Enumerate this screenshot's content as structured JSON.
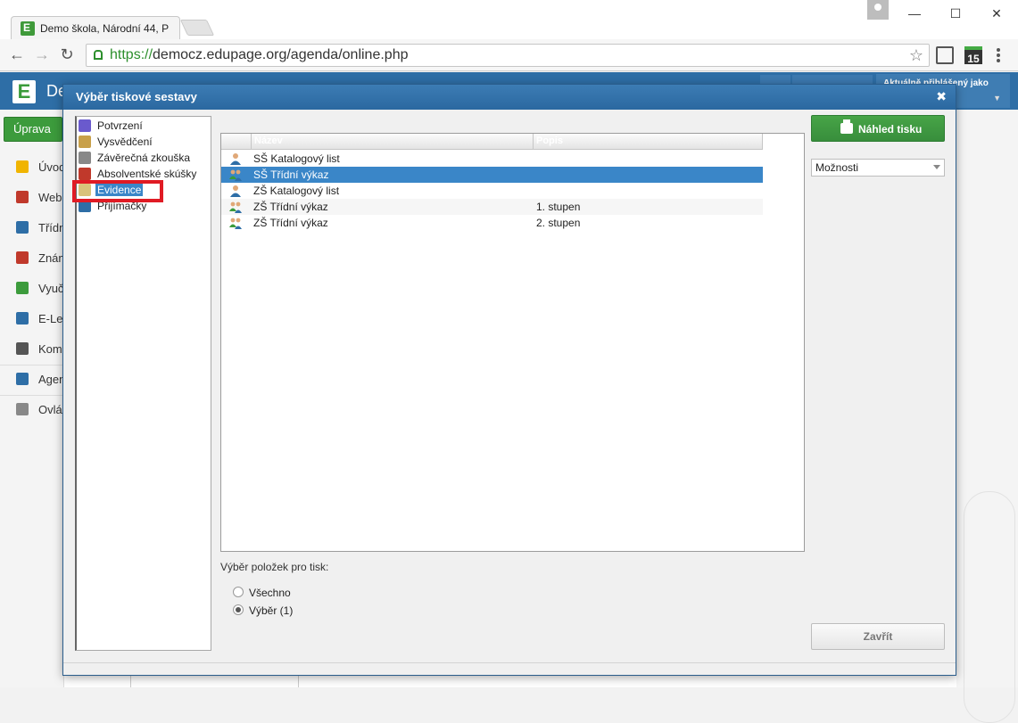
{
  "browser": {
    "tab_title": "Demo škola, Národní 44, P",
    "url_scheme": "https://",
    "url_rest": "democz.edupage.org/agenda/online.php",
    "minimize": "—",
    "maximize": "☐",
    "close": "✕",
    "calendar_badge": "15"
  },
  "app": {
    "logo_letter": "E",
    "title": "De",
    "login_text": "Aktuálně přihlášený jako",
    "edit_button": "Úprava",
    "sidebar": [
      {
        "label": "Úvod",
        "icon": "star-icon",
        "color": "#f0b400"
      },
      {
        "label": "Web",
        "icon": "web-icon",
        "color": "#c0392b"
      },
      {
        "label": "Třídn",
        "icon": "book-icon",
        "color": "#2e6ea6"
      },
      {
        "label": "Znám",
        "icon": "grades-icon",
        "color": "#c0392b"
      },
      {
        "label": "Vyuč",
        "icon": "teaching-icon",
        "color": "#3c9b3c"
      },
      {
        "label": "E-Le",
        "icon": "elearning-icon",
        "color": "#2e6ea6"
      },
      {
        "label": "Kom",
        "icon": "communication-icon",
        "color": "#555555"
      },
      {
        "label": "Agen",
        "icon": "pen-icon",
        "color": "#2e6ea6"
      },
      {
        "label": "Ovlá",
        "icon": "gear-icon",
        "color": "#888888"
      }
    ]
  },
  "dialog": {
    "title": "Výběr tiskové sestavy",
    "close_glyph": "✖",
    "tree": [
      {
        "label": "Potvrzení",
        "icon": "certificate-icon",
        "color": "#6a5acd"
      },
      {
        "label": "Vysvědčení",
        "icon": "report-card-icon",
        "color": "#c8a04a"
      },
      {
        "label": "Závěrečná zkouška",
        "icon": "exam-icon",
        "color": "#888888"
      },
      {
        "label": "Absolventské skúšky",
        "icon": "graduation-icon",
        "color": "#c0392b"
      },
      {
        "label": "Evidence",
        "icon": "folder-icon",
        "color": "#d9c37a",
        "selected": true
      },
      {
        "label": "Přijímačky",
        "icon": "admissions-icon",
        "color": "#2e6ea6"
      }
    ],
    "list": {
      "columns": [
        "Název",
        "Popis"
      ],
      "rows": [
        {
          "name": "SŠ Katalogový list",
          "desc": "",
          "icon": "person-icon",
          "selected": false
        },
        {
          "name": "SŠ Třídní výkaz",
          "desc": "",
          "icon": "group-icon",
          "selected": true
        },
        {
          "name": "ZŠ Katalogový list",
          "desc": "",
          "icon": "person-icon",
          "selected": false
        },
        {
          "name": "ZŠ Třídní výkaz",
          "desc": "1. stupen",
          "icon": "group-icon",
          "selected": false
        },
        {
          "name": "ZŠ Třídní výkaz",
          "desc": "2. stupen",
          "icon": "group-icon",
          "selected": false
        }
      ]
    },
    "print_preview_button": "Náhled tisku",
    "options_select": "Možnosti",
    "selection_label": "Výběr položek pro tisk:",
    "radio_all": "Všechno",
    "radio_selection": "Výběr (1)",
    "radio_selected": "selection",
    "close_button": "Zavřít"
  }
}
